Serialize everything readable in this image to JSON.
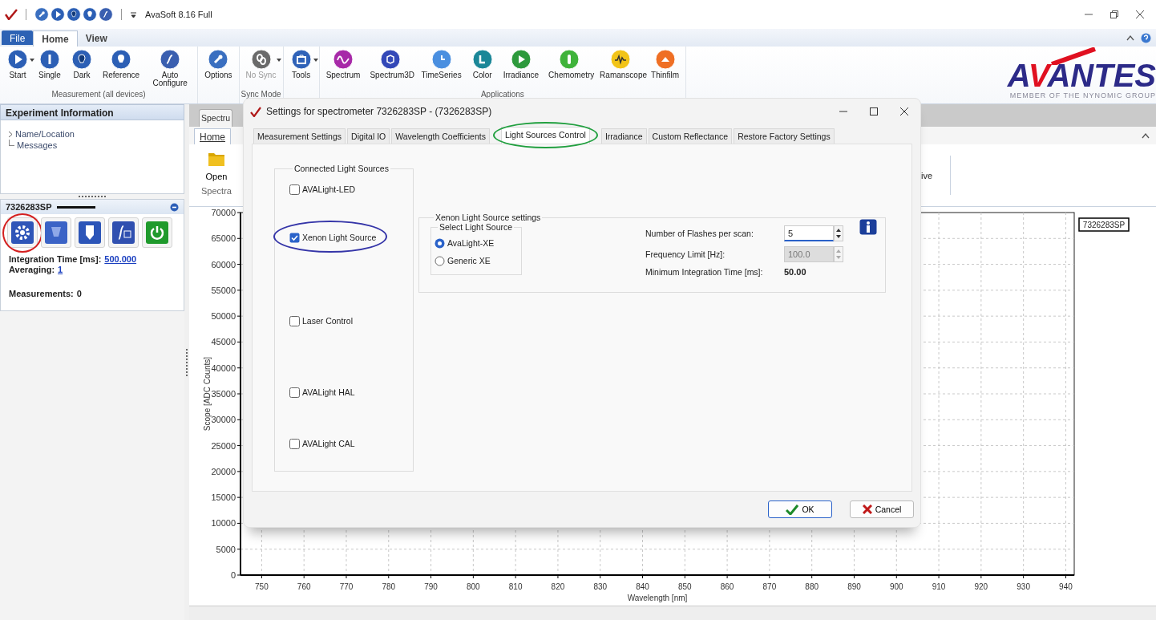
{
  "window": {
    "title": "AvaSoft 8.16 Full"
  },
  "quick_access": [
    {
      "kind": "wrench"
    },
    {
      "kind": "play"
    },
    {
      "kind": "dark"
    },
    {
      "kind": "reference"
    },
    {
      "kind": "auto"
    }
  ],
  "menu_tabs": [
    {
      "label": "File",
      "kind": "file",
      "selected": false
    },
    {
      "label": "Home",
      "kind": "tab",
      "selected": true
    },
    {
      "label": "View",
      "kind": "tab",
      "selected": false
    }
  ],
  "ribbon": {
    "groups": [
      {
        "label": "Measurement (all devices)",
        "buttons": [
          {
            "label": "Start",
            "kind": "play",
            "dropdown": true,
            "disabled": false
          },
          {
            "label": "Single",
            "kind": "single",
            "dropdown": false,
            "disabled": false
          },
          {
            "label": "Dark",
            "kind": "dark",
            "dropdown": false,
            "disabled": false
          },
          {
            "label": "Reference",
            "kind": "reference",
            "dropdown": false,
            "disabled": false
          },
          {
            "label": "Auto Configure",
            "kind": "auto",
            "dropdown": false,
            "disabled": false
          }
        ]
      },
      {
        "buttons": [
          {
            "label": "Options",
            "kind": "wrench",
            "dropdown": false,
            "disabled": false
          }
        ]
      },
      {
        "label": "Sync Mode",
        "buttons": [
          {
            "label": "No Sync",
            "kind": "link",
            "dropdown": true,
            "disabled": true
          }
        ]
      },
      {
        "buttons": [
          {
            "label": "Tools",
            "kind": "toolbox",
            "dropdown": true,
            "disabled": false
          }
        ]
      },
      {
        "label": "Applications",
        "buttons": [
          {
            "label": "Spectrum",
            "kind": "spectrum",
            "dropdown": false,
            "disabled": false
          },
          {
            "label": "Spectrum3D",
            "kind": "cube",
            "dropdown": false,
            "disabled": false
          },
          {
            "label": "TimeSeries",
            "kind": "clock",
            "dropdown": false,
            "disabled": false
          },
          {
            "label": "Color",
            "kind": "swatch",
            "dropdown": false,
            "disabled": false
          },
          {
            "label": "Irradiance",
            "kind": "triangle",
            "dropdown": false,
            "disabled": false
          },
          {
            "label": "Chemometry",
            "kind": "tube",
            "dropdown": false,
            "disabled": false
          },
          {
            "label": "Ramanscope",
            "kind": "peak",
            "dropdown": false,
            "disabled": false
          },
          {
            "label": "Thinfilm",
            "kind": "film",
            "dropdown": false,
            "disabled": false
          }
        ]
      }
    ],
    "logo": {
      "wordmark": "AVANTES",
      "tagline": "MEMBER OF THE NYNOMIC GROUP"
    }
  },
  "experiment_panel": {
    "title": "Experiment Information",
    "tree": [
      {
        "label": "Name/Location",
        "kind": "folder"
      },
      {
        "label": "Messages",
        "kind": "leaf"
      }
    ]
  },
  "device_panel": {
    "title": "7326283SP",
    "tools": [
      {
        "kind": "gear",
        "circled": true
      },
      {
        "kind": "dark",
        "circled": false
      },
      {
        "kind": "reference",
        "circled": false
      },
      {
        "kind": "auto",
        "circled": false
      },
      {
        "kind": "power",
        "circled": false
      }
    ],
    "fields": [
      {
        "label": "Integration Time  [ms]:",
        "value": "500.000",
        "kind": "link"
      },
      {
        "label": "Averaging:",
        "value": "1",
        "kind": "link"
      },
      {
        "label": "Measurements:",
        "value": "0",
        "kind": "text"
      }
    ]
  },
  "document": {
    "tab": "Spectru",
    "inner_tab": {
      "label": "Home",
      "selected": true
    },
    "open_button": "Open",
    "group_label": "Spectra",
    "cut_button": "ive",
    "chart": {
      "legend": "7326283SP",
      "chart_data": {
        "type": "line",
        "grid": true,
        "xlabel": "Wavelength [nm]",
        "ylabel": "Scope [ADC Counts]",
        "xlim": [
          745,
          942
        ],
        "ylim": [
          0,
          70000
        ],
        "xticks": [
          750,
          760,
          770,
          780,
          790,
          800,
          810,
          820,
          830,
          840,
          850,
          860,
          870,
          880,
          890,
          900,
          910,
          920,
          930,
          940
        ],
        "yticks": [
          0,
          5000,
          10000,
          15000,
          20000,
          25000,
          30000,
          35000,
          40000,
          45000,
          50000,
          55000,
          60000,
          65000,
          70000
        ]
      }
    }
  },
  "dialog": {
    "title": "Settings for spectrometer 7326283SP - (7326283SP)",
    "tabs": [
      {
        "label": "Measurement Settings",
        "selected": false,
        "circled": false
      },
      {
        "label": "Digital IO",
        "selected": false,
        "circled": false
      },
      {
        "label": "Wavelength Coefficients",
        "selected": false,
        "circled": false
      },
      {
        "label": "Light Sources Control",
        "selected": true,
        "circled": true
      },
      {
        "label": "Irradiance",
        "selected": false,
        "circled": false
      },
      {
        "label": "Custom Reflectance",
        "selected": false,
        "circled": false
      },
      {
        "label": "Restore Factory Settings",
        "selected": false,
        "circled": false
      }
    ],
    "connected": {
      "title": "Connected Light Sources",
      "items": [
        {
          "label": "AVALight-LED",
          "checked": false,
          "circled": false
        },
        {
          "label": "Xenon Light Source",
          "checked": true,
          "circled": true
        },
        {
          "label": "Laser Control",
          "checked": false,
          "circled": false
        },
        {
          "label": "AVALight HAL",
          "checked": false,
          "circled": false
        },
        {
          "label": "AVALight CAL",
          "checked": false,
          "circled": false
        }
      ]
    },
    "xenon": {
      "title": "Xenon Light Source settings",
      "select": {
        "title": "Select Light Source",
        "options": [
          {
            "label": "AvaLight-XE",
            "selected": true
          },
          {
            "label": "Generic XE",
            "selected": false
          }
        ]
      },
      "fields": [
        {
          "label": "Number of Flashes per scan:",
          "value": "5",
          "kind": "spin",
          "disabled": false
        },
        {
          "label": "Frequency Limit [Hz]:",
          "value": "100.0",
          "kind": "spin",
          "disabled": true
        },
        {
          "label": "Minimum Integration Time [ms]:",
          "value": "50.00",
          "kind": "readout",
          "disabled": false
        }
      ]
    },
    "buttons": [
      {
        "label": "OK",
        "kind": "ok"
      },
      {
        "label": "Cancel",
        "kind": "cancel"
      }
    ]
  }
}
